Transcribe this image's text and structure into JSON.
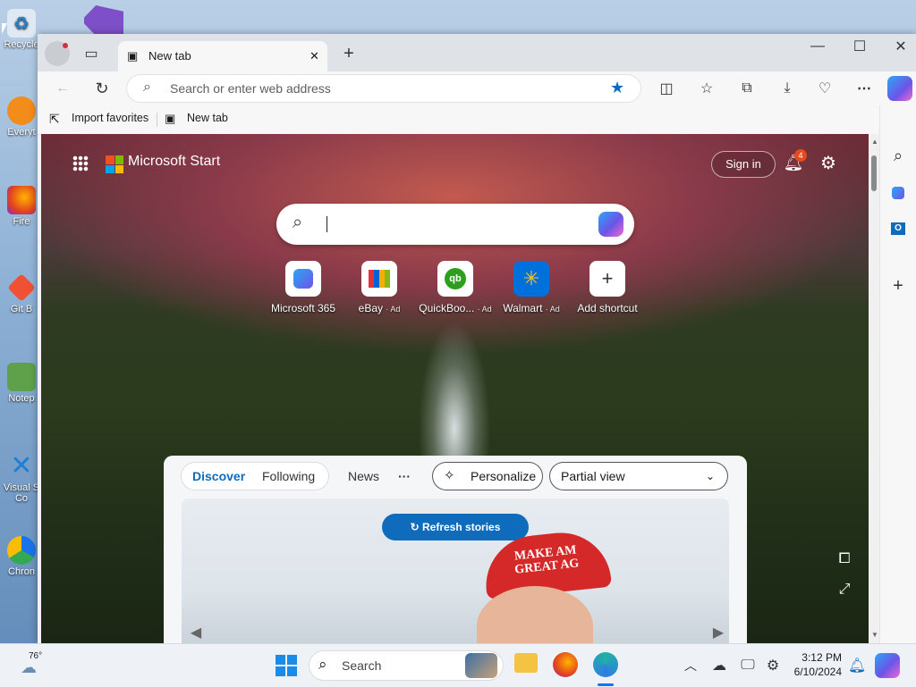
{
  "desktop": {
    "icons": [
      {
        "label": "Recycle",
        "icon": "recycle-bin-icon"
      },
      {
        "label": "Everyt",
        "icon": "everything-icon"
      },
      {
        "label": "Fire",
        "icon": "firefox-icon"
      },
      {
        "label": "Git B",
        "icon": "git-bash-icon"
      },
      {
        "label": "Notep",
        "icon": "notepad-icon"
      },
      {
        "label": "Visual S Co",
        "icon": "vscode-icon"
      },
      {
        "label": "Chron",
        "icon": "chrome-icon"
      }
    ]
  },
  "browser": {
    "tab": {
      "title": "New tab"
    },
    "address": {
      "placeholder": "Search or enter web address"
    },
    "favorites": [
      {
        "label": "Import favorites"
      },
      {
        "label": "New tab"
      }
    ],
    "window_controls": {
      "minimize": "—",
      "maximize": "☐",
      "close": "✕"
    }
  },
  "newtab": {
    "brand": "Microsoft Start",
    "sign_in": "Sign in",
    "notification_count": "4",
    "shortcuts": [
      {
        "label": "Microsoft 365",
        "ad": "",
        "icon": "microsoft365-icon"
      },
      {
        "label": "eBay",
        "ad": "· Ad",
        "icon": "ebay-icon"
      },
      {
        "label": "QuickBoo...",
        "ad": "· Ad",
        "icon": "quickbooks-icon"
      },
      {
        "label": "Walmart",
        "ad": "· Ad",
        "icon": "walmart-icon"
      },
      {
        "label": "Add shortcut",
        "ad": "",
        "icon": "plus-icon"
      }
    ],
    "feed": {
      "tabs": [
        "Discover",
        "Following"
      ],
      "news": "News",
      "more": "···",
      "personalize": "Personalize",
      "view_select": "Partial view",
      "refresh": "Refresh stories",
      "hat_text_1": "MAKE AM",
      "hat_text_2": "GREAT AG"
    }
  },
  "taskbar": {
    "weather": "76°",
    "search_placeholder": "Search",
    "time": "3:12 PM",
    "date": "6/10/2024"
  },
  "colors": {
    "accent": "#0f6cbd",
    "discover": "#0f6cbd",
    "badge": "#e8491d"
  }
}
